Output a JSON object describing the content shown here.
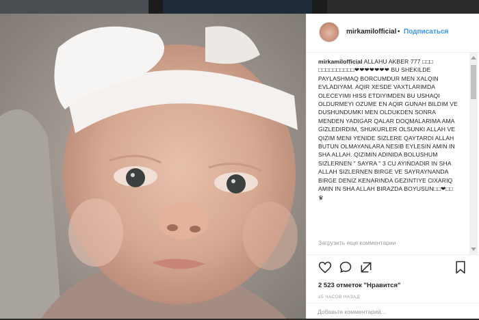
{
  "post": {
    "username": "mirkamilofficial",
    "separator": "•",
    "follow_label": "Подписаться",
    "caption_user": "mirkamilofficial",
    "caption_text": "ALLAHU AKBER 777 □□□ □□□□□□□□□□❤❤❤❤❤❤❤ BU SHEKILDE PAYLASHMAQ BORCUMDUR MEN XALQIN EVLADIYAM. AQIR XESDE VAXTLARIMDA OLECEYIMI HISS ETDIYIMDEN BU USHAQI OLDURMEYI OZUME EN AQIR GUNAH BILDIM VE DUSHUNDUMKI MEN OLDUKDEN SONRA MENDEN YADIGAR QALAR DOQMALARIMA AMA GIZLEDIRDIM, SHUKURLER OLSUNKI ALLAH VE QIZIM MENI YENIDE SIZLERE QAYTARDI ALLAH BUTUN OLMAYANLARA NESIB EYLESIN AMIN IN SHA ALLAH. QIZIMIN ADINIDA BOLUSHUM SIZLERNEN \" SAYRA \" 3 CU AYINDADIR IN SHA ALLAH SIZLERNEN BIRGE VE SAYRAYNANDA BIRGE DENIZ KENARINDA GEZINTIYE CIXARIQ AMIN IN SHA ALLAH BIRAZDA BOYUSUN□□❤□□ ♛",
    "load_more_comments": "Загрузить еще комментарии",
    "likes": "2 523 отметок \"Нравится\"",
    "time_ago": "15 ЧАСОВ НАЗАД",
    "comment_placeholder": "Добавьте комментарий..."
  },
  "icons": {
    "like": "heart-icon",
    "comment": "comment-icon",
    "share": "share-icon",
    "save": "bookmark-icon"
  },
  "colors": {
    "link": "#3897f0",
    "text": "#262626",
    "muted": "#999999"
  }
}
